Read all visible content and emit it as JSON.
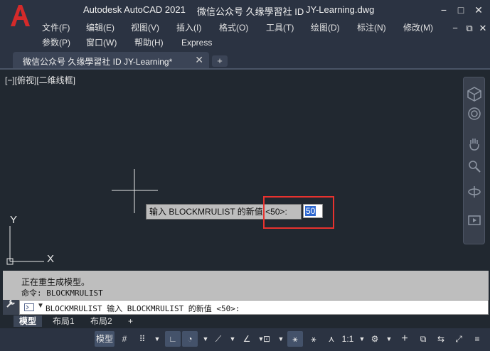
{
  "app": {
    "logo_letter": "A",
    "title_app": "Autodesk AutoCAD 2021",
    "title_extra": "微信公众号  久缘學習社 ID",
    "title_file": "JY-Learning.dwg"
  },
  "window_controls": {
    "minimize": "−",
    "restore": "□",
    "close": "✕",
    "sub_minimize": "−",
    "sub_restore": "⧉",
    "sub_close": "✕"
  },
  "menu": {
    "row1": [
      "文件(F)",
      "编辑(E)",
      "视图(V)",
      "插入(I)",
      "格式(O)",
      "工具(T)",
      "绘图(D)",
      "标注(N)",
      "修改(M)"
    ],
    "row2": [
      "参数(P)",
      "窗口(W)",
      "帮助(H)",
      "Express"
    ]
  },
  "tabs": {
    "active_label": "微信公众号  久缘學習社 ID  JY-Learning*",
    "close": "✕",
    "add": "+"
  },
  "viewport": {
    "label": "[−][俯视][二维线框]"
  },
  "ucs": {
    "y_label": "Y",
    "x_label": "X"
  },
  "dynamic_input": {
    "prompt": "输入 BLOCKMRULIST 的新值 <50>:",
    "value": "50"
  },
  "command": {
    "history": [
      "正在重生成模型。",
      "命令: BLOCKMRULIST"
    ],
    "current_prompt": "BLOCKMRULIST 输入 BLOCKMRULIST 的新值 <50>:"
  },
  "layout_tabs": {
    "model": "模型",
    "layout1": "布局1",
    "layout2": "布局2",
    "add": "+"
  },
  "statusbar": {
    "model": "模型",
    "scale": "1:1"
  },
  "colors": {
    "background": "#212830",
    "chrome": "#2b3342",
    "highlight": "#e8322e",
    "selection": "#2e68d0",
    "logo": "#d42a2a"
  }
}
